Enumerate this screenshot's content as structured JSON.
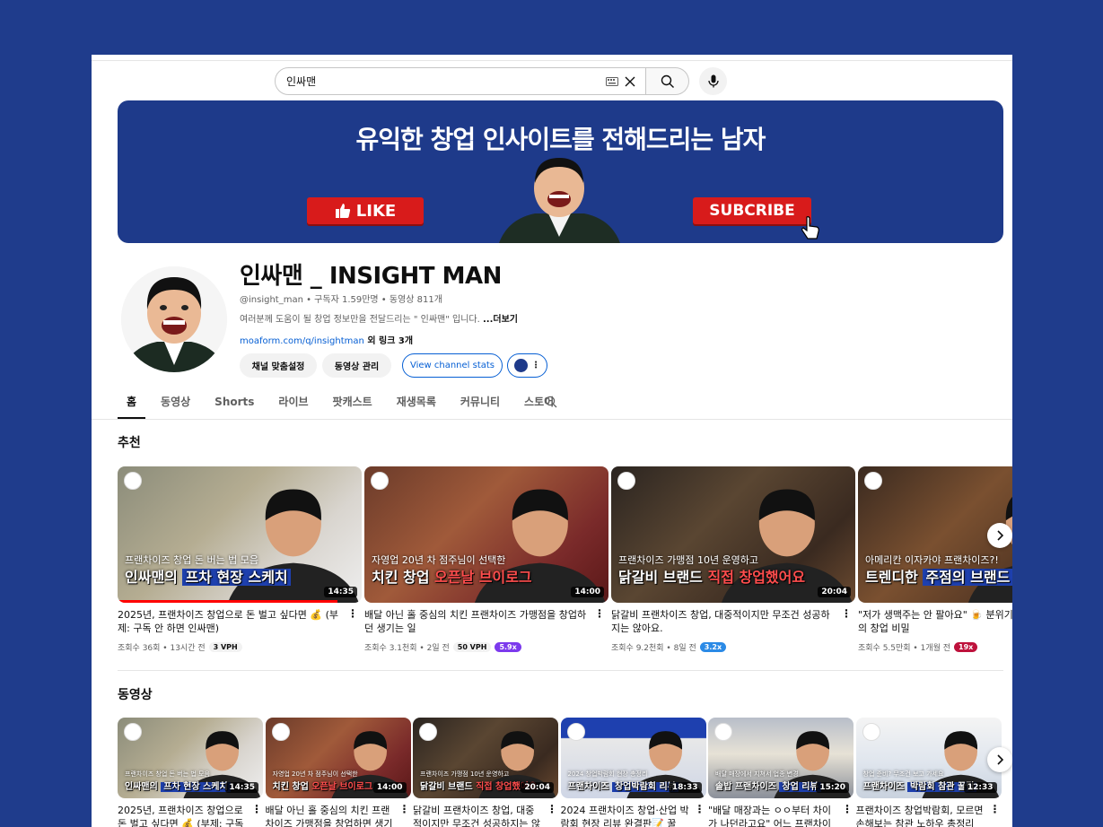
{
  "search": {
    "query": "인싸맨"
  },
  "banner": {
    "title": "유익한 창업 인사이트를 전해드리는 남자",
    "like_label": "LIKE",
    "subscribe_label": "SUBCRIBE"
  },
  "channel": {
    "name": "인싸맨 _ INSIGHT MAN",
    "meta": "@insight_man • 구독자 1.59만명 • 동영상 811개",
    "description": "여러분께 도움이 될 창업 정보만을 전달드리는 \" 인싸맨\" 입니다. ",
    "more_label": "...더보기",
    "link": "moaform.com/q/insightman",
    "link_extra": " 외 링크 3개",
    "buttons": {
      "customize": "채널 맞춤설정",
      "manage": "동영상 관리",
      "stats": "View channel stats"
    }
  },
  "tabs": [
    "홈",
    "동영상",
    "Shorts",
    "라이브",
    "팟캐스트",
    "재생목록",
    "커뮤니티",
    "스토어"
  ],
  "sections": {
    "recommended": "추천",
    "videos": "동영상"
  },
  "recommended": [
    {
      "overlay_top": "프랜차이즈 창업 돈 버는 법 모음",
      "overlay_a": "인싸맨의 ",
      "overlay_b": "프차 현장 스케치",
      "duration": "14:35",
      "title": "2025년, 프랜차이즈 창업으로 돈 벌고 싶다면 💰 (부제: 구독 안 하면 인싸맨)",
      "views": "조회수 36회 • 13시간 전",
      "vph": "3 VPH",
      "multiplier": "",
      "mult_color": ""
    },
    {
      "overlay_top": "자영업 20년 차 점주님이 선택한",
      "overlay_a": "치킨 창업 ",
      "overlay_b": "오픈날 브이로그",
      "duration": "14:00",
      "title": "배달 아닌 홀 중심의 치킨 프랜차이즈 가맹점을 창업하던 생기는 일",
      "views": "조회수 3.1천회 • 2일 전",
      "vph": "50 VPH",
      "multiplier": "5.9x",
      "mult_color": "#7c3aed"
    },
    {
      "overlay_top": "프랜차이즈 가맹점 10년 운영하고",
      "overlay_a": "닭갈비 브랜드 ",
      "overlay_b": "직접 창업했어요",
      "duration": "20:04",
      "title": "닭갈비 프랜차이즈 창업, 대중적이지만 무조건 성공하지는 않아요.",
      "views": "조회수 9.2천회 • 8일 전",
      "vph": "",
      "multiplier": "3.2x",
      "mult_color": "#2b8ae6"
    },
    {
      "overlay_top": "아메리칸 이자카야 프랜차이즈?!",
      "overlay_a": "트렌디한 ",
      "overlay_b": "주점의 브랜드",
      "duration": "",
      "title": "\"저가 생맥주는 안 팔아요\" 🍺 분위기 프랜차이즈 주점의 창업 비밀",
      "views": "조회수 5.5만회 • 1개월 전",
      "vph": "",
      "multiplier": "19x",
      "mult_color": "#be123c"
    }
  ],
  "videos": [
    {
      "overlay_top": "프랜차이즈 창업 돈 버는 법 모음",
      "overlay_a": "인싸맨의 ",
      "overlay_b": "프차 현장 스케치",
      "duration": "14:35",
      "title": "2025년, 프랜차이즈 창업으로 돈 벌고 싶다면 💰 (부제: 구독"
    },
    {
      "overlay_top": "자영업 20년 차 점주님이 선택한",
      "overlay_a": "치킨 창업 ",
      "overlay_b": "오픈날 브이로그",
      "duration": "14:00",
      "title": "배달 아닌 홀 중심의 치킨 프랜차이즈 가맹점을 창업하면 생기"
    },
    {
      "overlay_top": "프랜차이즈 가맹점 10년 운영하고",
      "overlay_a": "닭갈비 브랜드 ",
      "overlay_b": "직접 창업했어요",
      "duration": "20:04",
      "title": "닭갈비 프랜차이즈 창업, 대중적이지만 무조건 성공하지는 않"
    },
    {
      "overlay_top": "2024 창업박람회 현장 총정리",
      "overlay_a": "프랜차이즈 ",
      "overlay_b": "창업박람회 리뷰",
      "duration": "18:33",
      "title": "2024 프랜차이즈 창업·산업 박람회 현장 리뷰 완결판📝 꿀"
    },
    {
      "overlay_top": "배달 매장에서 지쳐서 업종 변경",
      "overlay_a": "솥밥 프랜차이즈 ",
      "overlay_b": "창업 리뷰",
      "duration": "15:20",
      "title": "\"배달 매장과는 ㅇㅇ부터 차이가 나던라고요\" 어느 프랜차이즈"
    },
    {
      "overlay_top": "창업 준비? 무조건 보고 가세요",
      "overlay_a": "프랜차이즈 ",
      "overlay_b": "박람회 참관 꿀팁",
      "duration": "12:33",
      "title": "프랜차이즈 창업박람회, 모르면 손해보는 참관 노하우 총정리"
    }
  ],
  "video_subtitle_1": "돈 벌고 싶다면 💰 (부제: 구독",
  "colors": {
    "accent": "#065fd4",
    "banner": "#1e3a8a",
    "background": "#1f3c8c",
    "red": "#d81b1b"
  }
}
